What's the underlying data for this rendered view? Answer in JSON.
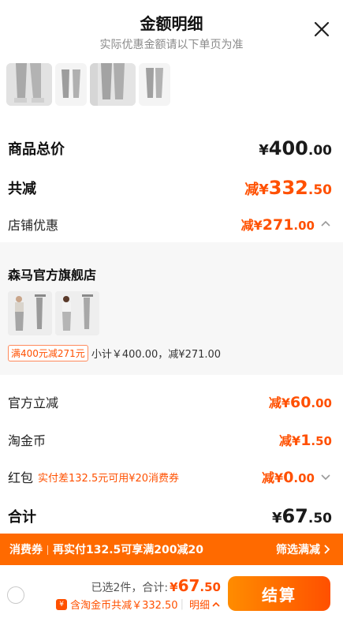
{
  "header": {
    "title": "金额明细",
    "subtitle": "实际优惠金额请以下单页为准"
  },
  "summary": {
    "goods_total": {
      "label": "商品总价",
      "prefix": "¥",
      "int": "400",
      "dec": ".00"
    },
    "total_discount": {
      "label": "共减",
      "prefix": "减¥",
      "int": "332",
      "dec": ".50"
    },
    "store_discount": {
      "label": "店铺优惠",
      "prefix": "减¥",
      "int": "271",
      "dec": ".00"
    }
  },
  "shop": {
    "name": "森马官方旗舰店",
    "promo_tag": "满400元减271元",
    "promo_text": "小计￥400.00，减¥271.00"
  },
  "discounts": {
    "official": {
      "label": "官方立减",
      "prefix": "减¥",
      "int": "60",
      "dec": ".00"
    },
    "taojinbi": {
      "label": "淘金币",
      "prefix": "减¥",
      "int": "1",
      "dec": ".50"
    },
    "redpacket": {
      "label": "红包",
      "sub": "实付差132.5元可用¥20消费券",
      "prefix": "减¥",
      "int": "0",
      "dec": ".00"
    }
  },
  "total": {
    "label": "合计",
    "prefix": "¥",
    "int": "67",
    "dec": ".50"
  },
  "banner": {
    "left_a": "消费券",
    "left_b": "再实付132.5可享满200减20",
    "right": "筛选满减"
  },
  "bottom_bar": {
    "selected": "已选2件，合计:",
    "prefix": "¥",
    "int": "67",
    "dec": ".50",
    "coin_icon_text": "¥",
    "coin_text": "含淘金币共减￥332.50",
    "detail": "明细",
    "checkout": "结算"
  },
  "colors": {
    "accent": "#ff5000",
    "banner": "#ff6a00",
    "shop_bg": "#f7f7f7"
  }
}
